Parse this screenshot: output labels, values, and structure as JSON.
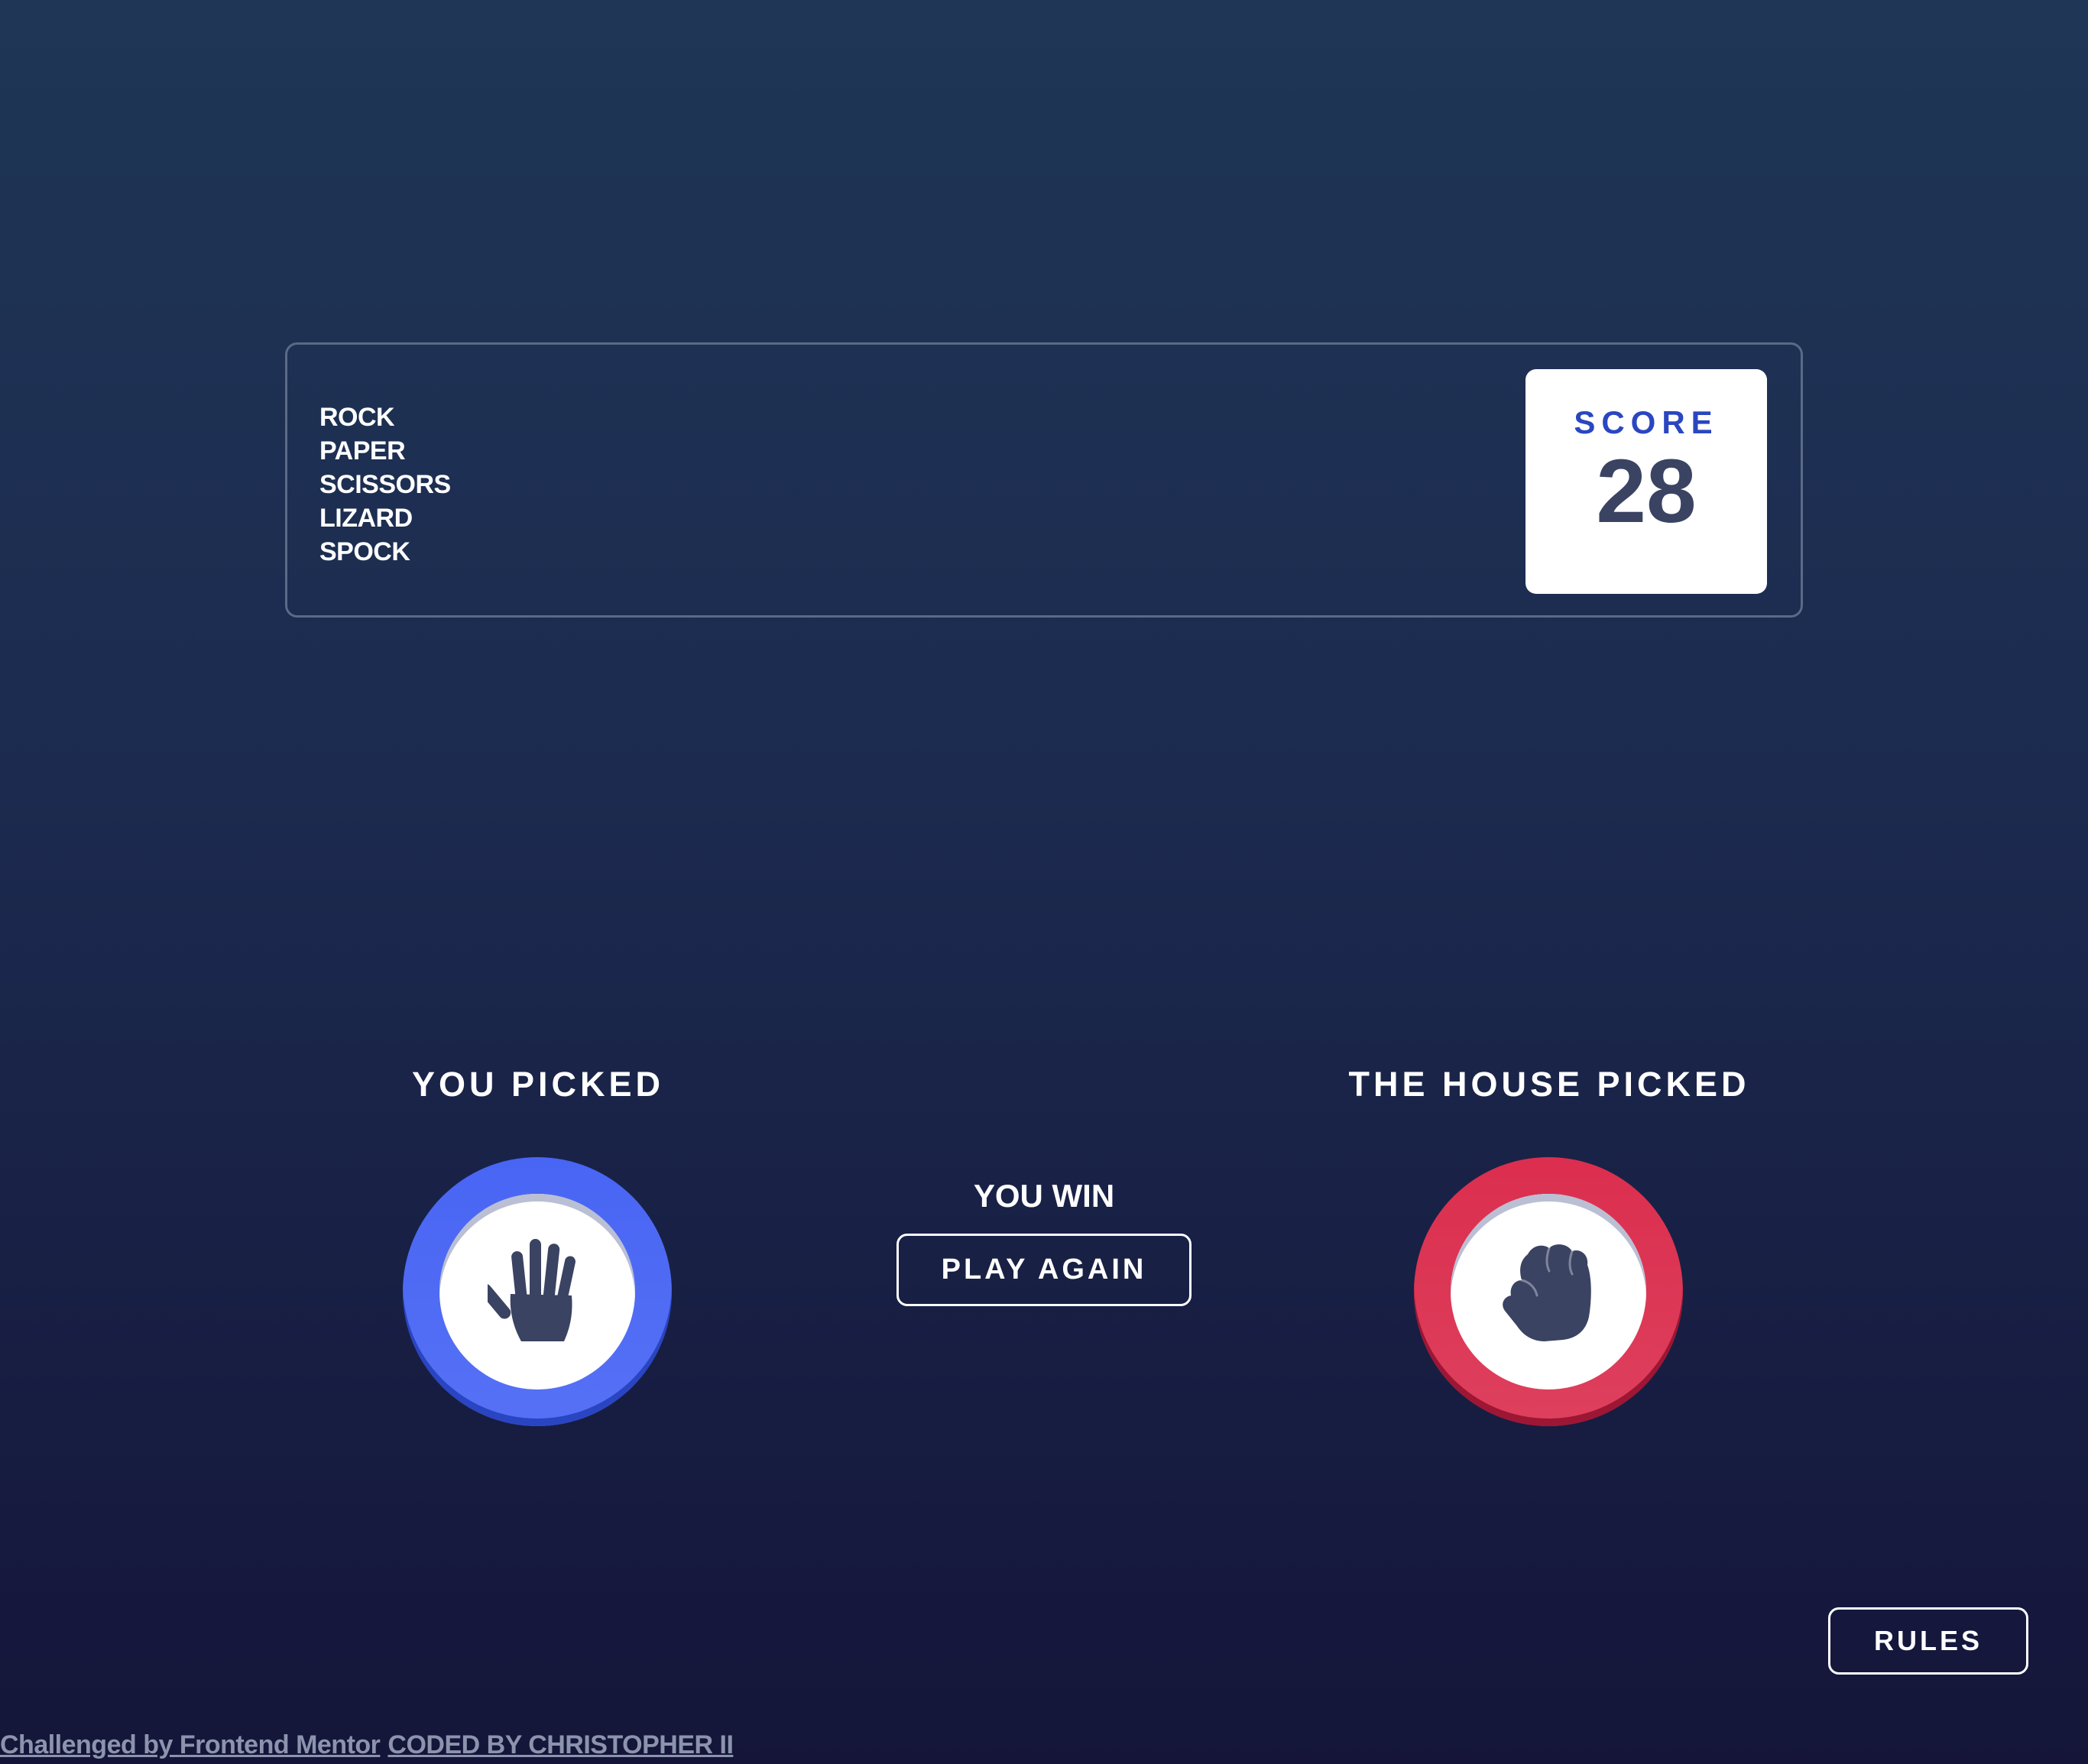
{
  "header": {
    "title_lines": [
      "ROCK",
      "PAPER",
      "SCISSORS",
      "LIZARD",
      "SPOCK"
    ],
    "score_label": "SCORE",
    "score_value": "28"
  },
  "player": {
    "label": "YOU PICKED",
    "choice": "paper",
    "icon": "paper-hand-icon",
    "ring_color": "#5671f5"
  },
  "house": {
    "label": "THE HOUSE PICKED",
    "choice": "rock",
    "icon": "rock-fist-icon",
    "ring_color": "#dc2e4e"
  },
  "result": {
    "text": "YOU WIN",
    "play_again_label": "PLAY AGAIN"
  },
  "rules_label": "RULES",
  "attribution": {
    "challenge_link": "Challenged by Frontend Mentor",
    "coded_by_link": "CODED BY CHRISTOPHER II"
  },
  "colors": {
    "icon_fill": "#3b4363",
    "score_label": "#2a46c0"
  }
}
